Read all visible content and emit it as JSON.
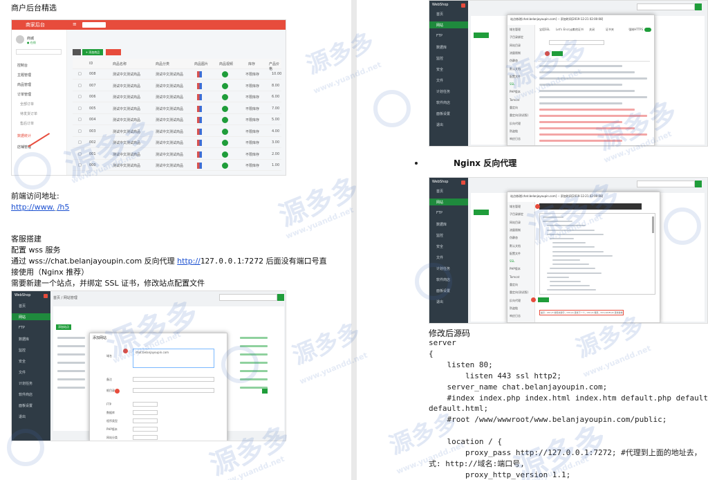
{
  "left": {
    "title": "商户后台精选",
    "front_label": "前端访问地址:",
    "front_url_start": "http://www.",
    "front_url_end": "/h5",
    "kefu_title": "客服搭建",
    "kefu_line1": "配置 wss 服务",
    "kefu_line2_a": "通过 wss://chat.belanjayoupin.com 反向代理 ",
    "kefu_line2_link": "http://",
    "kefu_line2_b": "127.0.0.1",
    "kefu_line2_c": ":7272 后面没有端口号直",
    "kefu_line3": "接使用（Nginx 推荐）",
    "kefu_line4": "需要新建一个站点，并绑定 SSL 证书，修改站点配置文件",
    "merchant_shot": {
      "brand": "商家后台",
      "shop_name": "商城",
      "sidebar": [
        "控制台",
        "主题管理",
        "商品管理",
        "订单管理",
        "全部订单",
        "待发货订单",
        "售后订单",
        "数据统计",
        "店铺管理"
      ],
      "toolbar_btn": "+ 添加商品",
      "columns": [
        "ID",
        "商品名称",
        "商品分类",
        "商品图片",
        "商品视频",
        "库存",
        "产品价格"
      ],
      "rows": [
        {
          "id": "008",
          "name": "测试中文测试商品",
          "cat": "测试中文测试商品",
          "stock": "不限库存",
          "price": "10.00"
        },
        {
          "id": "007",
          "name": "测试中文测试商品",
          "cat": "测试中文测试商品",
          "stock": "不限库存",
          "price": "8.00"
        },
        {
          "id": "006",
          "name": "测试中文测试商品",
          "cat": "测试中文测试商品",
          "stock": "不限库存",
          "price": "6.00"
        },
        {
          "id": "005",
          "name": "测试中文测试商品",
          "cat": "测试中文测试商品",
          "stock": "不限库存",
          "price": "7.00"
        },
        {
          "id": "004",
          "name": "测试中文测试商品",
          "cat": "测试中文测试商品",
          "stock": "不限库存",
          "price": "5.00"
        },
        {
          "id": "003",
          "name": "测试中文测试商品",
          "cat": "测试中文测试商品",
          "stock": "不限库存",
          "price": "4.00"
        },
        {
          "id": "002",
          "name": "测试中文测试商品",
          "cat": "测试中文测试商品",
          "stock": "不限库存",
          "price": "3.00"
        },
        {
          "id": "001",
          "name": "测试中文测试商品",
          "cat": "测试中文测试商品",
          "stock": "不限库存",
          "price": "2.00"
        },
        {
          "id": "000",
          "name": "测试中文测试商品",
          "cat": "测试中文测试商品",
          "stock": "不限库存",
          "price": "1.00"
        }
      ]
    },
    "site_shot": {
      "logo": "WebShop",
      "sidebar": [
        "首页",
        "网站",
        "FTP",
        "数据库",
        "监控",
        "安全",
        "文件",
        "计划任务",
        "软件商店",
        "面板设置",
        "退出"
      ],
      "breadcrumb": "首页 / 网站管理",
      "add_site_btn": "添加站点",
      "modal_title": "添加网站",
      "domain_value": "chat.belanjayoupin.com",
      "form_labels": [
        "域名",
        "备注",
        "根目录",
        "FTP",
        "数据库",
        "程序类型",
        "PHP版本",
        "网站分类"
      ]
    }
  },
  "right": {
    "nginx_title": "Nginx 反向代理",
    "modify_label": "修改后源码",
    "code_lines": [
      "server",
      "{",
      "    listen 80;",
      "        listen 443 ssl http2;",
      "    server_name chat.belanjayoupin.com;",
      "    #index index.php index.html index.htm default.php default.ht",
      "default.html;",
      "    #root /www/wwwroot/www.belanjayoupin.com/public;",
      "",
      "    location / {",
      "        proxy_pass http://127.0.0.1:7272; #代理到上面的地址去，",
      "式: http://域名:端口号,",
      "        proxy_http_version 1.1;"
    ],
    "shot1": {
      "logo": "WebShop",
      "modal_title": "站点修改[chat.belanjayoupin.com] -- 添加时间[2019-12-21 02:00:08]",
      "sidebar": [
        "首页",
        "网站",
        "FTP",
        "数据库",
        "监控",
        "安全",
        "文件",
        "计划任务",
        "软件商店",
        "面板设置",
        "退出"
      ],
      "modal_menu": [
        "域名管理",
        "子目录绑定",
        "网站目录",
        "流量限制",
        "伪静态",
        "默认文档",
        "配置文件",
        "SSL",
        "PHP版本",
        "Tomcat",
        "重定向",
        "重定向(测试版)",
        "反向代理",
        "防盗链",
        "响应日志"
      ],
      "tabs": [
        "宝塔SSL",
        "Let's Encrypt",
        "其他证书",
        "关闭",
        "证书夹"
      ],
      "force_https": "强制HTTPS"
    },
    "shot2": {
      "logo": "WebShop",
      "modal_title": "站点修改[chat.belanjayoupin.com] -- 添加时间[2019-12-21 02:00:08]",
      "hint": "提示：Ctrl+F 搜索关键字，Ctrl+G 查找下一个，Ctrl+S 保存，Ctrl+Shift+R 查找替换"
    },
    "search_value": "请输入"
  },
  "watermark": {
    "text": "源多多",
    "url": "www.yuandd.net",
    "letter": "Y"
  },
  "colors": {
    "red": "#e74c3c",
    "green": "#1f9d3a",
    "dark_sidebar": "#2f3b45",
    "link": "#1a4fd0"
  }
}
